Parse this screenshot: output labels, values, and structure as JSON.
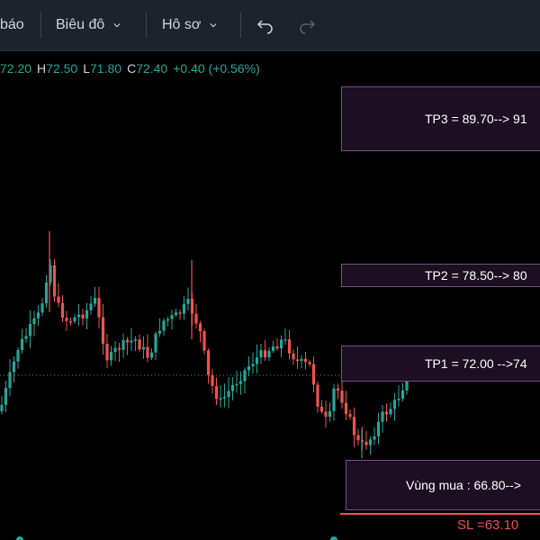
{
  "toolbar": {
    "items": [
      {
        "label": "báo"
      },
      {
        "label": "Biêu đô"
      },
      {
        "label": "Hô sơ"
      }
    ],
    "undo_icon": "undo-arrow-icon",
    "redo_icon": "redo-arrow-icon"
  },
  "ohlc": {
    "open_value": "72.20",
    "high_label": "H",
    "high_value": "72.50",
    "low_label": "L",
    "low_value": "71.80",
    "close_label": "C",
    "close_value": "72.40",
    "change": "+0.40 (+0.56%)"
  },
  "targets": {
    "tp3": "TP3 = 89.70--> 91",
    "tp2": "TP2 = 78.50--> 80",
    "tp1": "TP1 = 72.00 -->74",
    "buy_zone": "Vùng mua : 66.80-->",
    "stop_loss": "SL =63.10"
  },
  "colors": {
    "up_candle": "#26a69a",
    "down_candle": "#ef5350",
    "box_fill": "#1c0f21",
    "box_border": "#7a4a8c",
    "stop_loss_line": "#ef5350",
    "background": "#000000",
    "toolbar_bg": "#1e222d"
  }
}
